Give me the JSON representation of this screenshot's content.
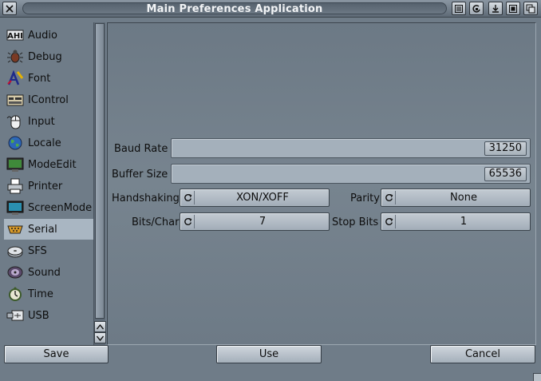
{
  "window": {
    "title": "Main Preferences Application",
    "titlebar_buttons": [
      "close-icon",
      "iconify-icon",
      "jump-icon",
      "snapshot-icon",
      "depth-icon",
      "zoom-icon"
    ]
  },
  "sidebar": {
    "items": [
      {
        "label": "Audio",
        "icon": "ahi-audio-icon"
      },
      {
        "label": "Debug",
        "icon": "bug-icon"
      },
      {
        "label": "Font",
        "icon": "font-icon"
      },
      {
        "label": "IControl",
        "icon": "control-panel-icon"
      },
      {
        "label": "Input",
        "icon": "mouse-icon"
      },
      {
        "label": "Locale",
        "icon": "globe-icon"
      },
      {
        "label": "ModeEdit",
        "icon": "monitor-edit-icon"
      },
      {
        "label": "Printer",
        "icon": "printer-icon"
      },
      {
        "label": "ScreenMode",
        "icon": "screen-icon"
      },
      {
        "label": "Serial",
        "icon": "serial-icon"
      },
      {
        "label": "SFS",
        "icon": "disk-icon"
      },
      {
        "label": "Sound",
        "icon": "speaker-icon"
      },
      {
        "label": "Time",
        "icon": "clock-icon"
      },
      {
        "label": "USB",
        "icon": "usb-icon"
      }
    ],
    "selected": "Serial"
  },
  "serial": {
    "baud_rate": {
      "label": "Baud Rate",
      "value": "31250"
    },
    "buffer_size": {
      "label": "Buffer Size",
      "value": "65536"
    },
    "handshaking": {
      "label": "Handshaking",
      "value": "XON/XOFF"
    },
    "parity": {
      "label": "Parity",
      "value": "None"
    },
    "bits_char": {
      "label": "Bits/Char",
      "value": "7"
    },
    "stop_bits": {
      "label": "Stop Bits",
      "value": "1"
    }
  },
  "buttons": {
    "save": "Save",
    "use": "Use",
    "cancel": "Cancel"
  },
  "colors": {
    "background": "#6f7c88",
    "selection": "#a9b6c2",
    "button_face": "#b9c2cb"
  }
}
